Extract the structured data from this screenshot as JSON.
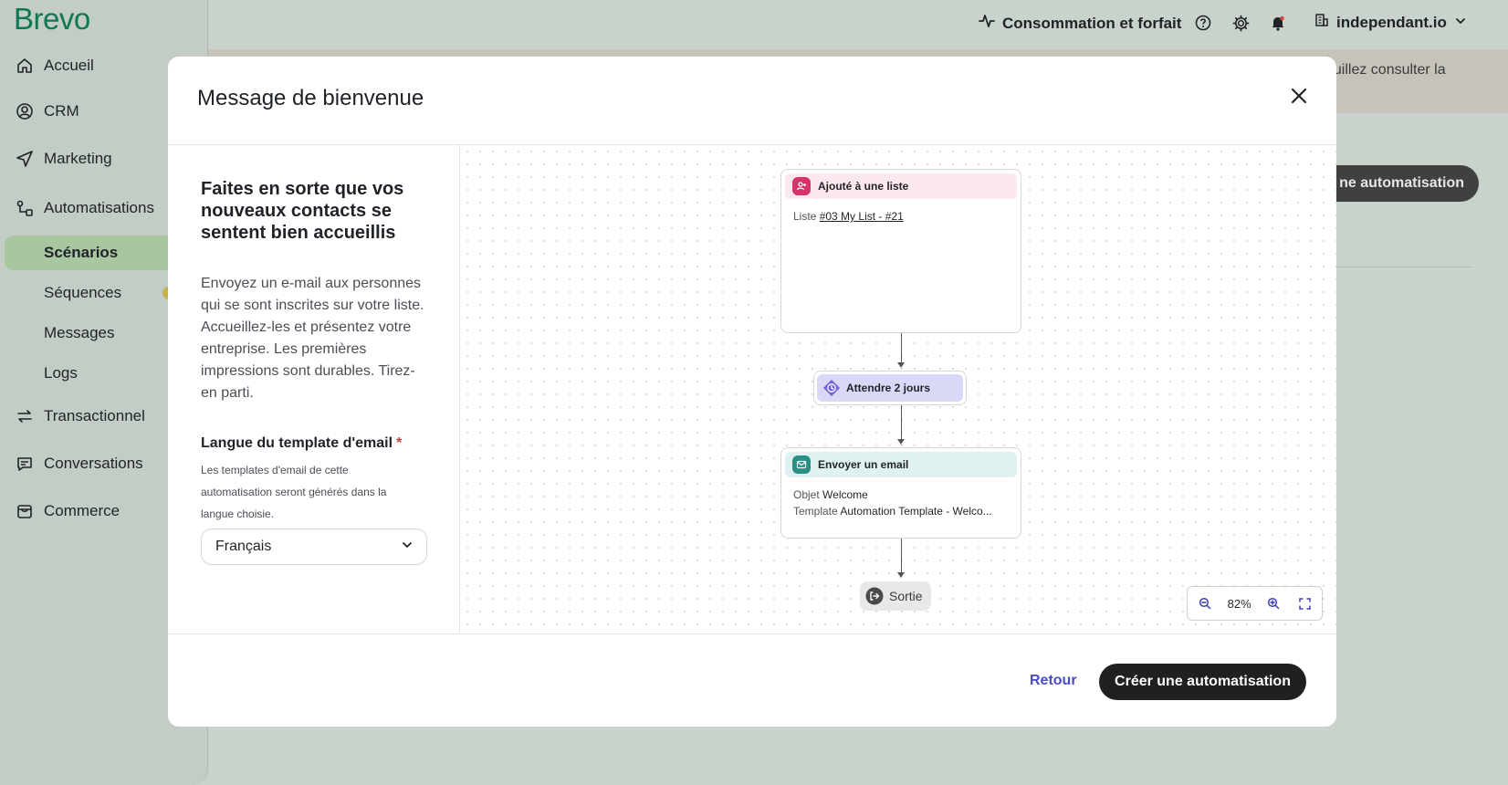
{
  "app": {
    "logo": "Brevo"
  },
  "sidebar": {
    "items": [
      {
        "label": "Accueil",
        "icon": "home-icon"
      },
      {
        "label": "CRM",
        "icon": "user-circle-icon"
      },
      {
        "label": "Marketing",
        "icon": "send-icon"
      },
      {
        "label": "Automatisations",
        "icon": "automation-icon"
      }
    ],
    "subitems": [
      {
        "label": "Scénarios",
        "active": true
      },
      {
        "label": "Séquences"
      },
      {
        "label": "Messages"
      },
      {
        "label": "Logs"
      }
    ],
    "items_bottom": [
      {
        "label": "Transactionnel",
        "icon": "transfer-icon"
      },
      {
        "label": "Conversations",
        "icon": "chat-icon"
      },
      {
        "label": "Commerce",
        "icon": "store-icon"
      }
    ]
  },
  "topbar": {
    "consumption": "Consommation et forfait",
    "account": "independant.io"
  },
  "background": {
    "banner_text": "euillez consulter la",
    "button_label": "ne automatisation"
  },
  "modal": {
    "title": "Message de bienvenue",
    "heading": "Faites en sorte que vos nouveaux contacts se sentent bien accueillis",
    "description": "Envoyez un e-mail aux personnes qui se sont inscrites sur votre liste. Accueillez-les et présentez votre entreprise. Les premières impressions sont durables. Tirez-en parti.",
    "language_label": "Langue du template d'email",
    "required_mark": "*",
    "language_help": "Les templates d'email de cette automatisation seront générés dans la langue choisie.",
    "language_value": "Français",
    "workflow": {
      "trigger": {
        "title": "Ajouté à une liste",
        "key": "Liste",
        "value": "#03 My List - #21"
      },
      "wait": {
        "title": "Attendre 2 jours"
      },
      "email": {
        "title": "Envoyer un email",
        "subject_key": "Objet",
        "subject_value": "Welcome",
        "template_key": "Template",
        "template_value": "Automation Template - Welco..."
      },
      "exit": {
        "title": "Sortie"
      }
    },
    "zoom": "82%",
    "back_label": "Retour",
    "create_label": "Créer une automatisation"
  },
  "colors": {
    "brand": "#0b7a54",
    "trigger_head": "#fce8ee",
    "trigger_icon": "#d6336c",
    "wait_head": "#d9d8f7",
    "wait_icon": "#7065d8",
    "email_head": "#dff2f1",
    "email_icon": "#2a8f86",
    "link": "#4b4bc7"
  }
}
